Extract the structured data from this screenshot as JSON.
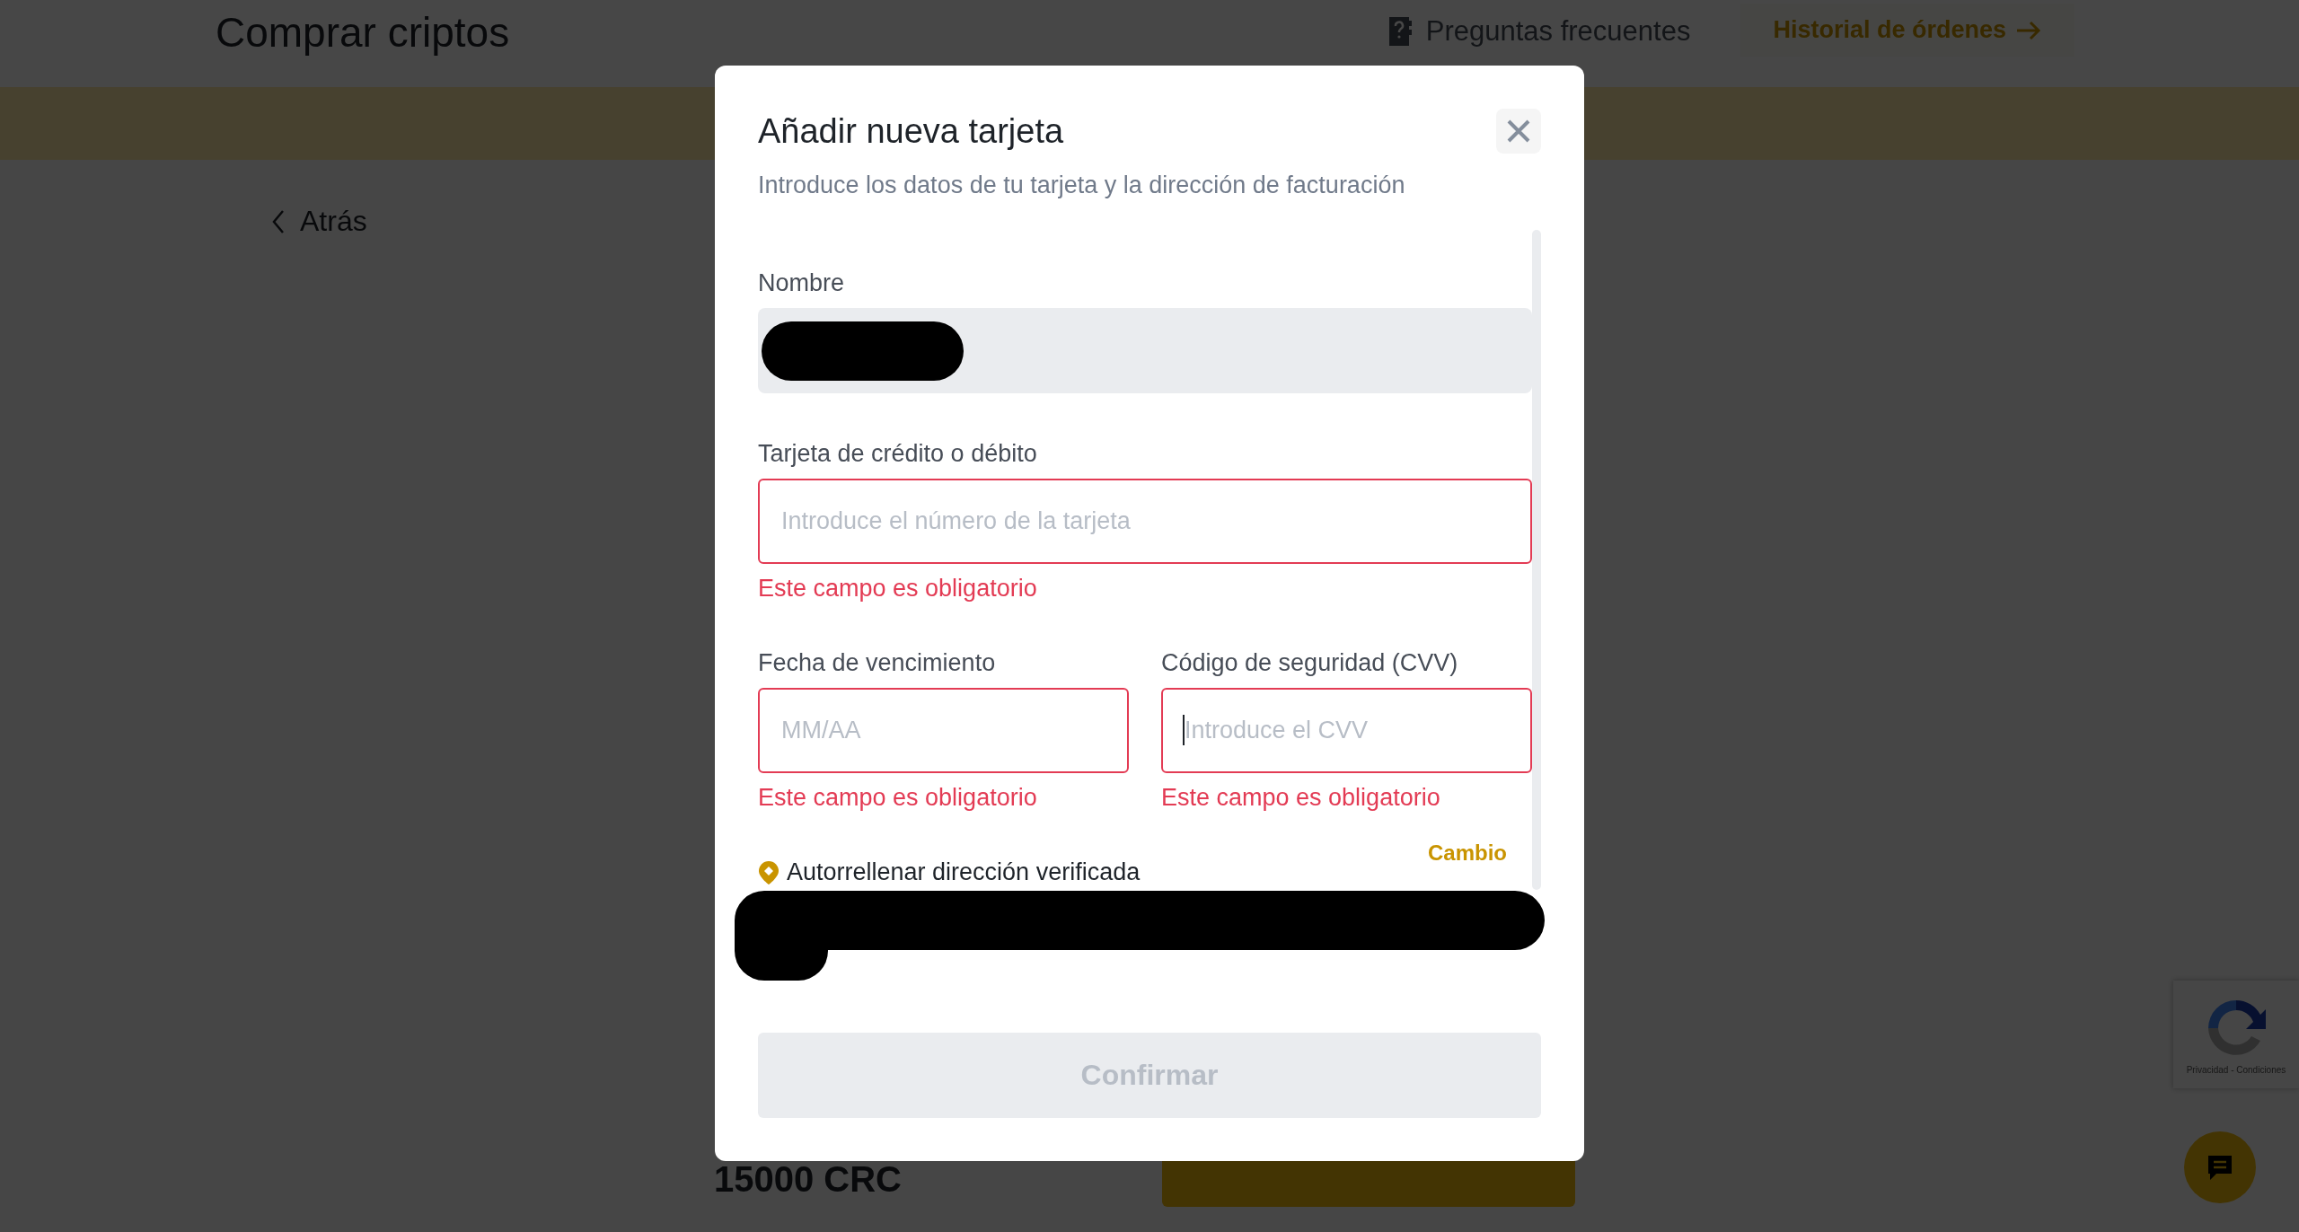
{
  "page": {
    "title": "Comprar criptos",
    "faq_link": "Preguntas frecuentes",
    "history_button": "Historial de órdenes",
    "back_link": "Atrás",
    "amount": "15000 CRC"
  },
  "modal": {
    "title": "Añadir nueva tarjeta",
    "subtitle": "Introduce los datos de tu tarjeta y la dirección de facturación",
    "rows": [
      [
        {
          "kind": "redacted",
          "label": "Nombre"
        }
      ],
      [
        {
          "kind": "input",
          "label": "Tarjeta de crédito o débito",
          "placeholder": "Introduce el número de la tarjeta",
          "error": "Este campo es obligatorio",
          "focused": false
        }
      ],
      [
        {
          "kind": "input",
          "label": "Fecha de vencimiento",
          "placeholder": "MM/AA",
          "error": "Este campo es obligatorio",
          "focused": false
        },
        {
          "kind": "input",
          "label": "Código de seguridad (CVV)",
          "placeholder": "Introduce el CVV",
          "error": "Este campo es obligatorio",
          "focused": true
        }
      ]
    ],
    "address": {
      "label": "Autorrellenar dirección verificada",
      "action": "Cambio",
      "redacted": true
    },
    "confirm_button": {
      "label": "Confirmar",
      "disabled": true
    }
  },
  "recaptcha": {
    "links": "Privacidad - Condiciones"
  }
}
